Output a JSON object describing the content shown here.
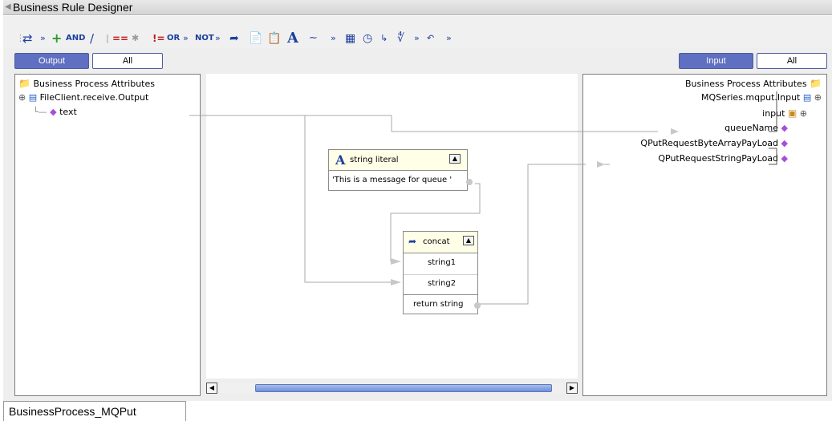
{
  "window": {
    "title": "Business Rule Designer"
  },
  "toolbar": {
    "and_label": "AND",
    "or_label": "OR",
    "not_label": "NOT"
  },
  "output_tabs": {
    "output": "Output",
    "all": "All"
  },
  "input_tabs": {
    "input": "Input",
    "all": "All"
  },
  "left_tree": {
    "root": "Business Process Attributes",
    "child": "FileClient.receive.Output",
    "leaf": "text"
  },
  "right_tree": {
    "root": "Business Process Attributes",
    "child": "MQSeries.mqput.Input",
    "input_node": "input",
    "fields": [
      "queueName",
      "QPutRequestByteArrayPayLoad",
      "QPutRequestStringPayLoad"
    ]
  },
  "literal_node": {
    "title": "string literal",
    "value": "'This is a message for queue '"
  },
  "concat_node": {
    "title": "concat",
    "inputs": [
      "string1",
      "string2"
    ],
    "output": "return string"
  },
  "bottom_tab": {
    "label": "BusinessProcess_MQPut"
  }
}
